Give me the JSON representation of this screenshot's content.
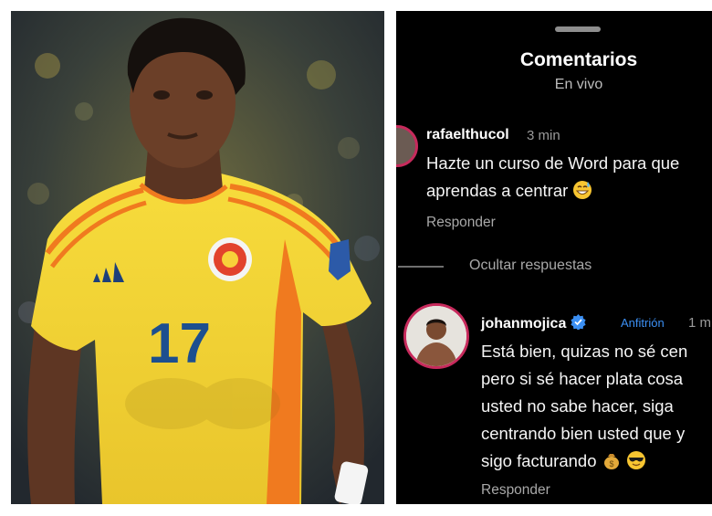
{
  "photo": {
    "jersey_number": "17",
    "icons": [
      "adidas-logo-icon",
      "fcf-crest-icon",
      "fifa-badge-icon"
    ],
    "colors": {
      "jersey": "#f2d53a",
      "accent": "#f07a1f",
      "number": "#1d4f8f",
      "skin": "#6b3f28"
    }
  },
  "comments_panel": {
    "title": "Comentarios",
    "subtitle": "En vivo",
    "comment1": {
      "user": "rafaelthucol",
      "time": "3 min",
      "lines": [
        "Hazte un curso de Word para que",
        "aprendas a centrar"
      ],
      "emoji": "grinning-sweat-emoji",
      "reply": "Responder"
    },
    "hide_replies": "Ocultar respuestas",
    "comment2": {
      "user": "johanmojica",
      "badge": "Anfitrión",
      "time": "1 m",
      "lines": [
        "Está bien, quizas no sé cen",
        "pero si sé hacer plata cosa",
        "usted no sabe hacer, siga",
        "centrando bien usted que y",
        "sigo facturando"
      ],
      "emojis": [
        "money-bag-emoji",
        "sunglasses-emoji"
      ],
      "reply": "Responder"
    },
    "colors": {
      "background": "#000000",
      "story_ring": "#c72a5c",
      "verified": "#3b8ff3"
    }
  }
}
